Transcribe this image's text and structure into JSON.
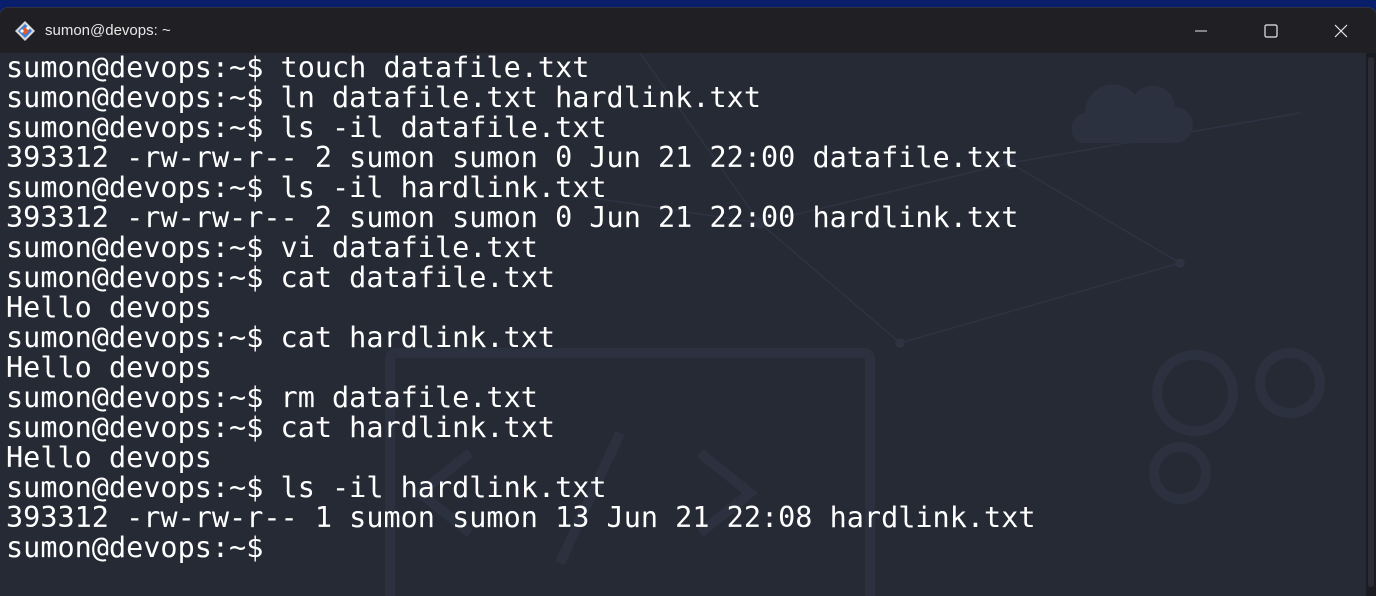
{
  "window": {
    "title": "sumon@devops: ~",
    "app_icon": "git-bash-icon"
  },
  "controls": {
    "minimize": "minimize-icon",
    "maximize": "maximize-icon",
    "close": "close-icon"
  },
  "terminal": {
    "lines": [
      "sumon@devops:~$ touch datafile.txt",
      "sumon@devops:~$ ln datafile.txt hardlink.txt",
      "sumon@devops:~$ ls -il datafile.txt",
      "393312 -rw-rw-r-- 2 sumon sumon 0 Jun 21 22:00 datafile.txt",
      "sumon@devops:~$ ls -il hardlink.txt",
      "393312 -rw-rw-r-- 2 sumon sumon 0 Jun 21 22:00 hardlink.txt",
      "sumon@devops:~$ vi datafile.txt",
      "sumon@devops:~$ cat datafile.txt",
      "Hello devops",
      "sumon@devops:~$ cat hardlink.txt",
      "Hello devops",
      "sumon@devops:~$ rm datafile.txt",
      "sumon@devops:~$ cat hardlink.txt",
      "Hello devops",
      "sumon@devops:~$ ls -il hardlink.txt",
      "393312 -rw-rw-r-- 1 sumon sumon 13 Jun 21 22:08 hardlink.txt",
      "sumon@devops:~$"
    ]
  },
  "colors": {
    "desktop": "#0a1f6b",
    "terminal_bg": "#262a35",
    "titlebar_bg": "#202024",
    "text": "#ffffff"
  }
}
